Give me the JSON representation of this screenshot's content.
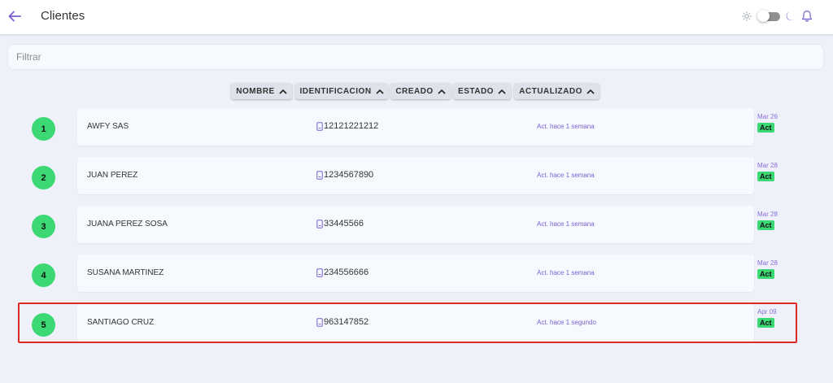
{
  "header": {
    "title": "Clientes"
  },
  "filter": {
    "placeholder": "Filtrar",
    "value": ""
  },
  "sort_buttons": [
    {
      "label": "NOMBRE"
    },
    {
      "label": "IDENTIFICACION"
    },
    {
      "label": "CREADO"
    },
    {
      "label": "ESTADO"
    },
    {
      "label": "ACTUALIZADO"
    }
  ],
  "clients": [
    {
      "num": "1",
      "name": "AWFY SAS",
      "id": "12121221212",
      "updated": "Act. hace 1 semana",
      "date": "Mar 26",
      "status": "Act"
    },
    {
      "num": "2",
      "name": "JUAN PEREZ",
      "id": "1234567890",
      "updated": "Act. hace 1 semana",
      "date": "Mar 28",
      "status": "Act"
    },
    {
      "num": "3",
      "name": "JUANA PEREZ SOSA",
      "id": "33445566",
      "updated": "Act. hace 1 semana",
      "date": "Mar 28",
      "status": "Act"
    },
    {
      "num": "4",
      "name": "SUSANA MARTINEZ",
      "id": "234556666",
      "updated": "Act. hace 1 semana",
      "date": "Mar 28",
      "status": "Act"
    },
    {
      "num": "5",
      "name": "SANTIAGO CRUZ",
      "id": "963147852",
      "updated": "Act. hace 1 segundo",
      "date": "Apr 09",
      "status": "Act"
    }
  ],
  "theme": {
    "accent": "#7a5fd0",
    "status_green": "#3cd873",
    "highlight": "#e02a2a",
    "dark_mode": false
  },
  "icons": {
    "back": "arrow-left-icon",
    "sun": "sun-icon",
    "moon": "moon-icon",
    "bell": "bell-icon",
    "sort": "chevron-up-icon",
    "id": "id-card-icon"
  }
}
